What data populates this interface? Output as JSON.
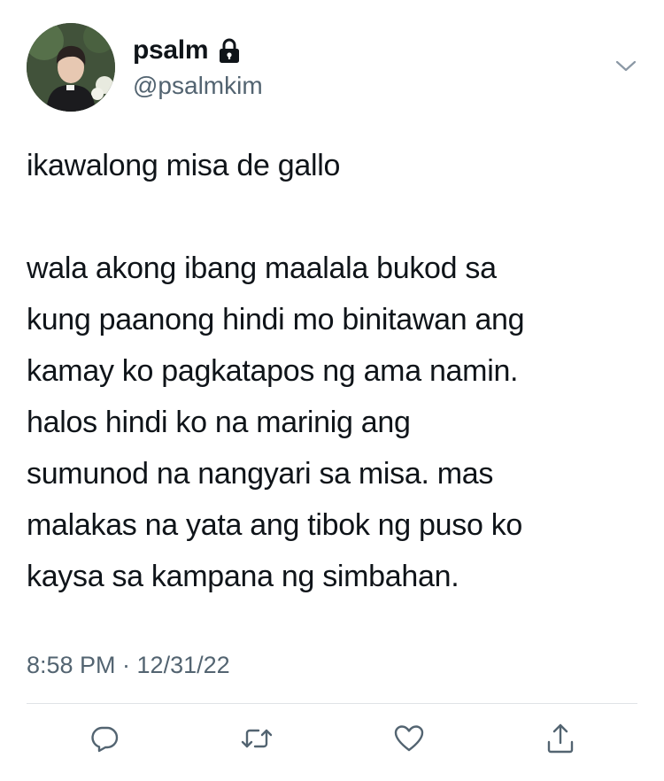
{
  "profile": {
    "display_name": "psalm",
    "handle": "@psalmkim",
    "protected_icon": "lock-icon",
    "avatar": "profile-photo"
  },
  "tweet": {
    "first_line": "ikawalong misa de gallo",
    "body": "wala akong ibang maalala bukod sa\nkung paanong hindi mo binitawan ang\nkamay ko pagkatapos ng ama namin.\nhalos hindi ko na marinig ang\nsumunod na nangyari sa misa. mas\nmalakas na yata ang tibok ng puso ko\nkaysa sa kampana ng simbahan.",
    "timestamp": "8:58 PM · 12/31/22"
  },
  "actions": {
    "icons": [
      "reply-icon",
      "retweet-icon",
      "like-icon",
      "share-icon"
    ]
  },
  "colors": {
    "text": "#0f1419",
    "secondary": "#536471",
    "icon": "#536471",
    "divider": "#dfe3e6"
  }
}
